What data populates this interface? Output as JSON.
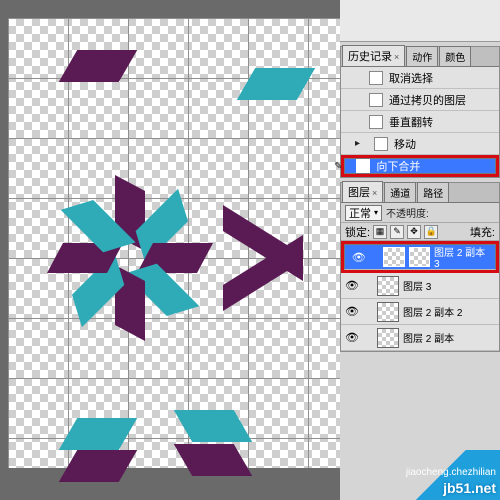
{
  "canvas": {
    "shape_color_purple": "#5a1a54",
    "shape_color_teal": "#2faab7"
  },
  "history_panel": {
    "tabs": {
      "history": "历史记录",
      "actions": "动作",
      "color": "颜色"
    },
    "items": [
      {
        "label": "取消选择"
      },
      {
        "label": "通过拷贝的图层"
      },
      {
        "label": "垂直翻转"
      },
      {
        "label": "移动"
      },
      {
        "label": "向下合并",
        "selected": true
      }
    ]
  },
  "layers_panel": {
    "tabs": {
      "layers": "图层",
      "channels": "通道",
      "paths": "路径"
    },
    "blend_mode": "正常",
    "opacity_label": "不透明度:",
    "lock_label": "锁定:",
    "fill_label": "填充:",
    "layers": [
      {
        "name": "图层 2 副本 3",
        "visible": true,
        "selected": true
      },
      {
        "name": "图层 3",
        "visible": true
      },
      {
        "name": "图层 2 副本 2",
        "visible": true
      },
      {
        "name": "图层 2 副本",
        "visible": true
      }
    ]
  },
  "watermark": {
    "site": "jb51.net",
    "sub": "jiaocheng.chezhilian"
  }
}
